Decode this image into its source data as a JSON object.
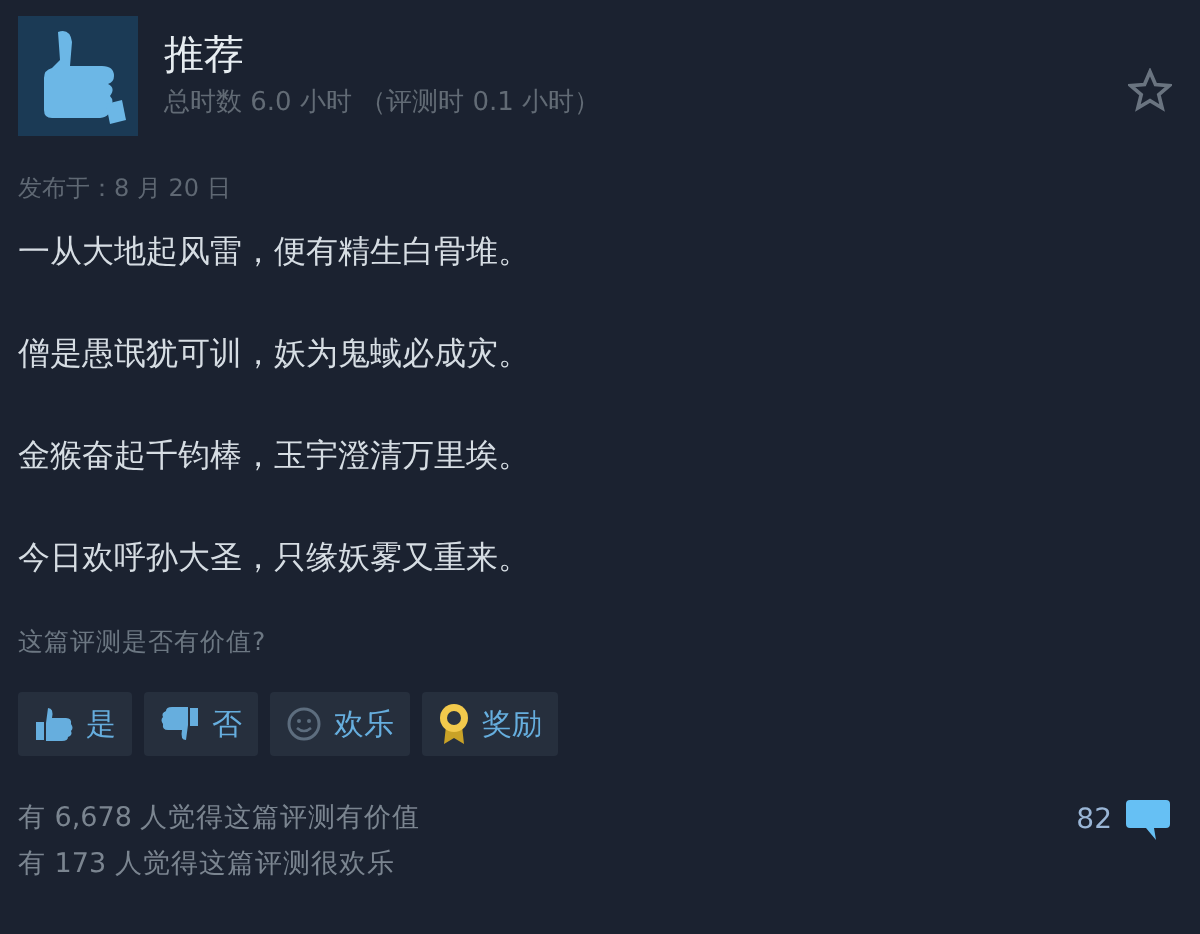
{
  "review": {
    "verdict": "推荐",
    "hours": "总时数 6.0 小时 （评测时 0.1 小时）",
    "posted": "发布于：8 月 20 日"
  },
  "paragraphs": [
    "一从大地起风雷，便有精生白骨堆。",
    "僧是愚氓犹可训，妖为鬼蜮必成灾。",
    "金猴奋起千钧棒，玉宇澄清万里埃。",
    "今日欢呼孙大圣，只缘妖雾又重来。"
  ],
  "helpful_prompt": "这篇评测是否有价值?",
  "buttons": [
    {
      "kind": "thumbs-up",
      "label": "是"
    },
    {
      "kind": "thumbs-down",
      "label": "否"
    },
    {
      "kind": "smile",
      "label": "欢乐"
    },
    {
      "kind": "award",
      "label": "奖励"
    }
  ],
  "stats": [
    "有 6,678 人觉得这篇评测有价值",
    "有 173 人觉得这篇评测很欢乐"
  ],
  "comments": "82"
}
